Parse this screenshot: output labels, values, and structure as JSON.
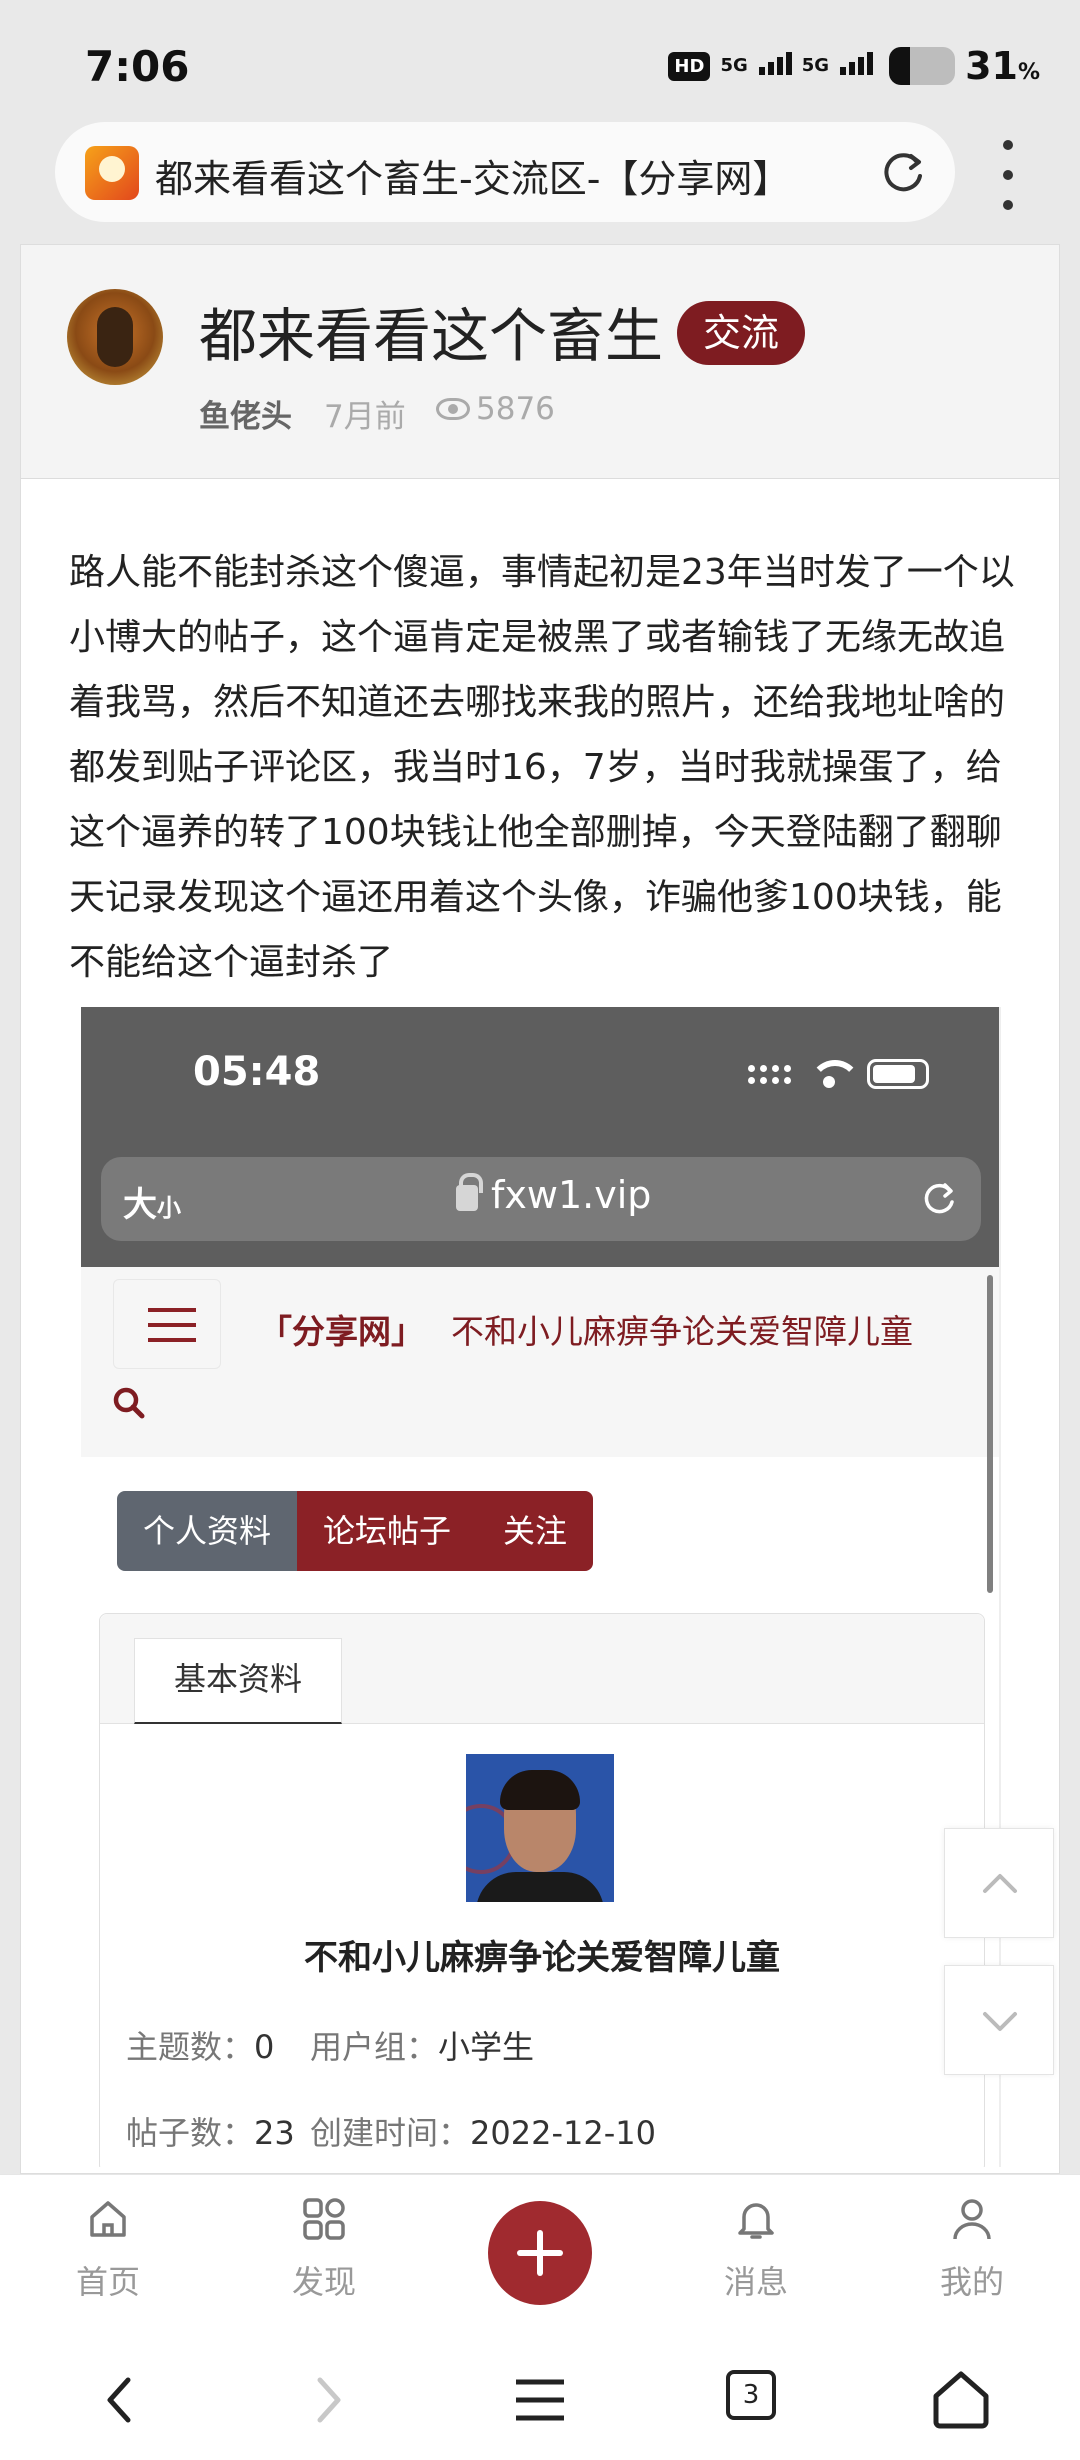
{
  "status_bar": {
    "time": "7:06",
    "network_badge": "HD",
    "signal1": "5G",
    "signal2": "5G",
    "battery_percent": "31",
    "battery_unit": "%",
    "battery_level": 0.31
  },
  "browser": {
    "tab_title": "都来看看这个畜生-交流区-【分享网】",
    "reload_icon": "reload-icon",
    "menu_icon": "more-vertical-icon"
  },
  "post": {
    "title": "都来看看这个畜生",
    "tag": "交流",
    "author": "鱼佬头",
    "time": "7月前",
    "views": "5876",
    "body": "路人能不能封杀这个傻逼，事情起初是23年当时发了一个以小博大的帖子，这个逼肯定是被黑了或者输钱了无缘无故追着我骂，然后不知道还去哪找来我的照片，还给我地址啥的都发到贴子评论区，我当时16，7岁，当时我就操蛋了，给这个逼养的转了100块钱让他全部删掉，今天登陆翻了翻聊天记录发现这个逼还用着这个头像，诈骗他爹100块钱，能不能给这个逼封杀了"
  },
  "screenshot": {
    "time": "05:48",
    "text_size": "大",
    "text_size_small": "小",
    "domain": "fxw1.vip",
    "brand": "「分享网」",
    "brand_tagline": "不和小儿麻痹争论关爱智障儿童",
    "tabs": [
      "个人资料",
      "论坛帖子",
      "关注"
    ],
    "panel_tab": "基本资料",
    "username": "不和小儿麻痹争论关爱智障儿童",
    "stats": {
      "topics_label": "主题数：",
      "topics_value": "0",
      "group_label": "用户组：",
      "group_value": "小学生",
      "posts_label": "帖子数：",
      "posts_value": "23",
      "created_label": "创建时间：",
      "created_value": "2022-12-10"
    }
  },
  "app_nav": {
    "items": [
      {
        "label": "首页",
        "icon": "home-icon"
      },
      {
        "label": "发现",
        "icon": "grid-icon"
      },
      {
        "label": "消息",
        "icon": "bell-icon"
      },
      {
        "label": "我的",
        "icon": "user-icon"
      }
    ],
    "add_icon": "plus-icon"
  },
  "system_nav": {
    "tab_count": "3"
  },
  "colors": {
    "accent": "#7e1c21",
    "tab_gray": "#5f6670"
  }
}
